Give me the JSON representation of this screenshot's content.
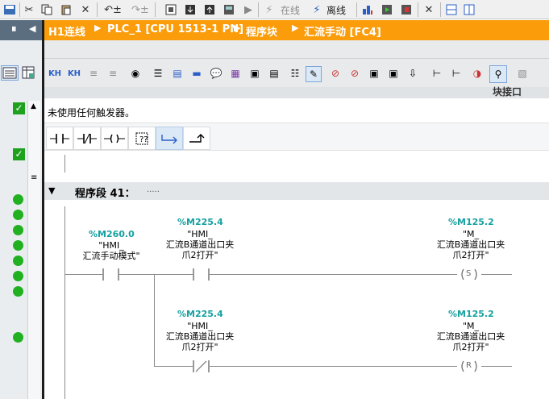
{
  "toolbar": {
    "online_label": "在线",
    "offline_label": "离线"
  },
  "breadcrumb": {
    "items": [
      "H1连线",
      "PLC_1 [CPU 1513-1 PN]",
      "程序块",
      "汇流手动 [FC4]"
    ]
  },
  "panel": {
    "interface_label": "块接口"
  },
  "editor": {
    "block_note": "未使用任何触发器。",
    "network_title": "程序段 41：",
    "network_comment": "....."
  },
  "network": {
    "contact1": {
      "address": "%M260.0",
      "name_line1": "\"HMI_",
      "name_line2": "汇流手动模式\""
    },
    "contact2": {
      "address": "%M225.4",
      "name_line1": "\"HMI_",
      "name_line2": "汇流B通道出口夹",
      "name_line3": "爪2打开\""
    },
    "coil_set": {
      "address": "%M125.2",
      "name_line1": "\"M_",
      "name_line2": "汇流B通道出口夹",
      "name_line3": "爪2打开\"",
      "symbol": "S"
    },
    "contact3": {
      "address": "%M225.4",
      "name_line1": "\"HMI_",
      "name_line2": "汇流B通道出口夹",
      "name_line3": "爪2打开\""
    },
    "coil_reset": {
      "address": "%M125.2",
      "name_line1": "\"M_",
      "name_line2": "汇流B通道出口夹",
      "name_line3": "爪2打开\"",
      "symbol": "R"
    }
  },
  "colors": {
    "accent": "#fb9c0a",
    "address": "#16a0a0",
    "status_ok": "#20b020"
  }
}
